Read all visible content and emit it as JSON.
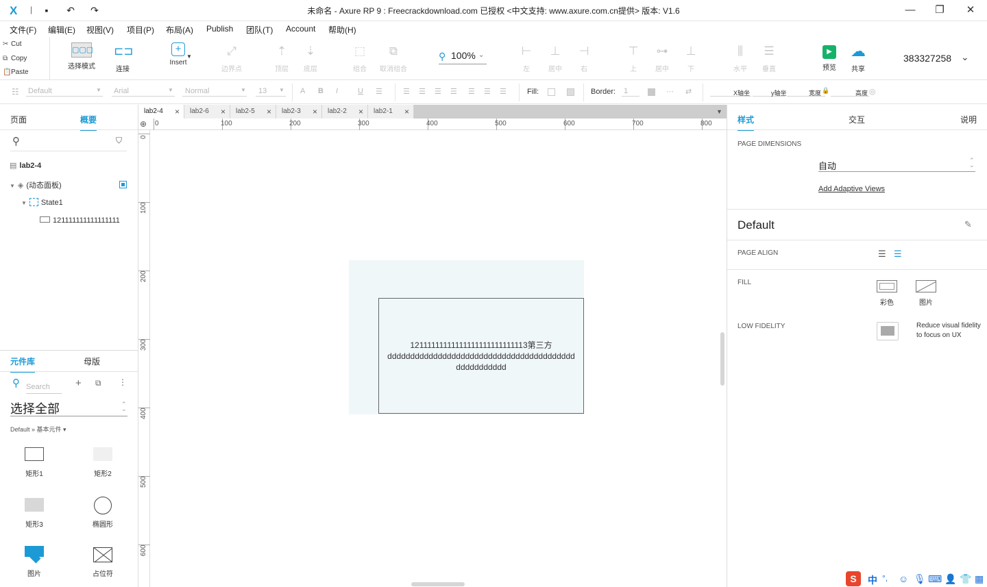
{
  "app": {
    "logo": "X",
    "title": "未命名 - Axure RP 9 : Freecrackdownload.com 已授权   <中文支持: www.axure.com.cn提供> 版本: V1.6"
  },
  "menu": [
    "文件(F)",
    "编辑(E)",
    "视图(V)",
    "项目(P)",
    "布局(A)",
    "Publish",
    "团队(T)",
    "Account",
    "帮助(H)"
  ],
  "clipboard": {
    "cut": "Cut",
    "copy": "Copy",
    "paste": "Paste"
  },
  "toolbar": {
    "select_mode": "选择模式",
    "connect": "连接",
    "insert": "Insert",
    "point": "边界点",
    "top": "顶层",
    "bottom": "底层",
    "group": "组合",
    "ungroup": "取消组合",
    "zoom": "100%",
    "left": "左",
    "center": "居中",
    "right": "右",
    "up": "上",
    "middle": "居中",
    "down": "下",
    "horizontal": "水平",
    "vertical": "垂直",
    "preview": "预览",
    "share": "共享",
    "user_id": "383327258"
  },
  "stylebar": {
    "style": "Default",
    "font": "Arial",
    "weight": "Normal",
    "size": "13",
    "fill_label": "Fill:",
    "border_label": "Border:",
    "border_value": "1",
    "x_label": "X轴坐",
    "y_label": "y轴坐",
    "w_label": "宽度",
    "h_label": "高度"
  },
  "left_panel": {
    "tabs": {
      "pages": "页面",
      "outline": "概要"
    },
    "outline": {
      "page": "lab2-4",
      "dynamic_panel": "(动态面板)",
      "state": "State1",
      "shape": "121111111111111111"
    },
    "lib_tabs": {
      "library": "元件库",
      "masters": "母版"
    },
    "search_placeholder": "Search",
    "select_all": "选择全部",
    "breadcrumb": "Default » 基本元件 ▾",
    "widgets": [
      "矩形1",
      "矩形2",
      "矩形3",
      "椭圆形",
      "图片",
      "占位符"
    ]
  },
  "canvas": {
    "tabs": [
      "lab2-4",
      "lab2-6",
      "lab2-5",
      "lab2-3",
      "lab2-2",
      "lab2-1"
    ],
    "ruler_h": [
      "0",
      "100",
      "200",
      "300",
      "400",
      "500",
      "600",
      "700",
      "800"
    ],
    "ruler_v": [
      "0",
      "100",
      "200",
      "300",
      "400",
      "500",
      "600"
    ],
    "shape_text_line1": "12111111111111111111111111113第三方",
    "shape_text_line2": "ddddddddddddddddddddddddddddddddddddddddd",
    "shape_text_line3": "ddddddddddd"
  },
  "right_panel": {
    "tabs": {
      "style": "样式",
      "interactions": "交互",
      "notes": "说明"
    },
    "page_dimensions_label": "PAGE DIMENSIONS",
    "page_dimensions_value": "自动",
    "adaptive_views_link": "Add Adaptive Views",
    "style_name": "Default",
    "page_align_label": "PAGE ALIGN",
    "fill_label": "FILL",
    "fill_color": "彩色",
    "fill_image": "图片",
    "low_fidelity_label": "LOW FIDELITY",
    "low_fidelity_desc1": "Reduce visual fidelity",
    "low_fidelity_desc2": "to focus on UX"
  },
  "ime": {
    "chinese": "中"
  },
  "colors": {
    "accent": "#1c9ad6",
    "preview_green": "#17b26a",
    "canvas_shape_fill": "#eff7f9"
  }
}
